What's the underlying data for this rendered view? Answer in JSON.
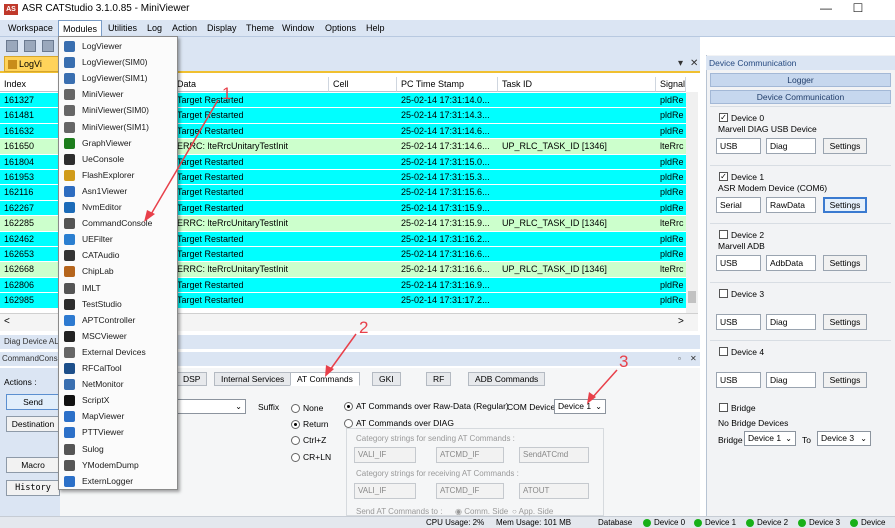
{
  "window": {
    "logo_text": "AS",
    "title": "ASR CATStudio 3.1.0.85 - MiniViewer",
    "minimize": "—",
    "maximize": "☐"
  },
  "menu": [
    "Workspace",
    "Modules",
    "Utilities",
    "Log",
    "Action",
    "Display",
    "Theme",
    "Window",
    "Options",
    "Help"
  ],
  "doc_tab": {
    "label": "LogVi"
  },
  "strip_controls": {
    "pin": "▾",
    "close": "✕"
  },
  "grid": {
    "columns": [
      "Index",
      "Data",
      "Cell",
      "PC Time Stamp",
      "Task ID",
      "Signal"
    ],
    "rows": [
      {
        "index": "161327",
        "data": "Target Restarted",
        "cell": "",
        "ts": "25-02-14 17:31:14.0...",
        "task": "",
        "signal": "pldRe",
        "hl": false
      },
      {
        "index": "161481",
        "data": "Target Restarted",
        "cell": "",
        "ts": "25-02-14 17:31:14.3...",
        "task": "",
        "signal": "pldRe",
        "hl": false
      },
      {
        "index": "161632",
        "data": "Target Restarted",
        "cell": "",
        "ts": "25-02-14 17:31:14.6...",
        "task": "",
        "signal": "pldRe",
        "hl": false
      },
      {
        "index": "161650",
        "data": "ERRC: lteRrcUnitaryTestInit",
        "cell": "",
        "ts": "25-02-14 17:31:14.6...",
        "task": "UP_RLC_TASK_ID [1346]",
        "signal": "lteRrc",
        "hl": true
      },
      {
        "index": "161804",
        "data": "Target Restarted",
        "cell": "",
        "ts": "25-02-14 17:31:15.0...",
        "task": "",
        "signal": "pldRe",
        "hl": false
      },
      {
        "index": "161953",
        "data": "Target Restarted",
        "cell": "",
        "ts": "25-02-14 17:31:15.3...",
        "task": "",
        "signal": "pldRe",
        "hl": false
      },
      {
        "index": "162116",
        "data": "Target Restarted",
        "cell": "",
        "ts": "25-02-14 17:31:15.6...",
        "task": "",
        "signal": "pldRe",
        "hl": false
      },
      {
        "index": "162267",
        "data": "Target Restarted",
        "cell": "",
        "ts": "25-02-14 17:31:15.9...",
        "task": "",
        "signal": "pldRe",
        "hl": false
      },
      {
        "index": "162285",
        "data": "ERRC: lteRrcUnitaryTestInit",
        "cell": "",
        "ts": "25-02-14 17:31:15.9...",
        "task": "UP_RLC_TASK_ID [1346]",
        "signal": "lteRrc",
        "hl": true
      },
      {
        "index": "162462",
        "data": "Target Restarted",
        "cell": "",
        "ts": "25-02-14 17:31:16.2...",
        "task": "",
        "signal": "pldRe",
        "hl": false
      },
      {
        "index": "162653",
        "data": "Target Restarted",
        "cell": "",
        "ts": "25-02-14 17:31:16.6...",
        "task": "",
        "signal": "pldRe",
        "hl": false
      },
      {
        "index": "162668",
        "data": "ERRC: lteRrcUnitaryTestInit",
        "cell": "",
        "ts": "25-02-14 17:31:16.6...",
        "task": "UP_RLC_TASK_ID [1346]",
        "signal": "lteRrc",
        "hl": true
      },
      {
        "index": "162806",
        "data": "Target Restarted",
        "cell": "",
        "ts": "25-02-14 17:31:16.9...",
        "task": "",
        "signal": "pldRe",
        "hl": false
      },
      {
        "index": "162985",
        "data": "Target Restarted",
        "cell": "",
        "ts": "25-02-14 17:31:17.2...",
        "task": "",
        "signal": "pldRe",
        "hl": false
      }
    ]
  },
  "scroll": {
    "left": "<",
    "right": ">"
  },
  "bottom": {
    "diag_strip": "Diag Device AL",
    "cmd_title": "CommandCons",
    "actions_label": "Actions :",
    "send": "Send",
    "destination": "Destination",
    "macro": "Macro",
    "history": "History",
    "tabs": [
      "DSP",
      "Internal Services",
      "AT Commands",
      "GKI",
      "RF",
      "ADB Commands"
    ],
    "active_tab": "AT Commands",
    "suffix_label": "Suffix",
    "suffix_options": [
      "None",
      "Return",
      "Ctrl+Z",
      "CR+LN"
    ],
    "suffix_selected": "Return",
    "mode_raw": "AT Commands over Raw-Data (Regular)",
    "mode_diag": "AT Commands over DIAG",
    "com_device_label": "COM Device:",
    "com_device_value": "Device 1",
    "send_cat_label": "Category strings for sending AT Commands :",
    "send_cat_values": [
      "VALI_IF",
      "ATCMD_IF",
      "SendATCmd"
    ],
    "recv_cat_label": "Category strings for receiving AT Commands :",
    "recv_cat_values": [
      "VALI_IF",
      "ATCMD_IF",
      "ATOUT"
    ],
    "send_to_label": "Send AT Commands to :",
    "send_to_options": [
      "Comm. Side",
      "App. Side"
    ]
  },
  "status": {
    "cpu": "CPU Usage: 2%",
    "mem": "Mem Usage: 101 MB",
    "db": "Database",
    "devices": [
      "Device 0",
      "Device 1",
      "Device 2",
      "Device 3",
      "Device"
    ]
  },
  "right_panel": {
    "title": "Device Communication",
    "logger_header": "Logger",
    "devcomm_header": "Device Communication",
    "devices": [
      {
        "name": "Device 0",
        "checked": true,
        "desc": "Marvell DIAG USB Device",
        "port": "USB",
        "proto": "Diag",
        "btn": "Settings"
      },
      {
        "name": "Device 1",
        "checked": true,
        "desc": "ASR Modem Device (COM6)",
        "port": "Serial",
        "proto": "RawData",
        "btn": "Settings"
      },
      {
        "name": "Device 2",
        "checked": false,
        "desc": "Marvell ADB",
        "port": "USB",
        "proto": "AdbData",
        "btn": "Settings"
      },
      {
        "name": "Device 3",
        "checked": false,
        "desc": "",
        "port": "USB",
        "proto": "Diag",
        "btn": "Settings"
      },
      {
        "name": "Device 4",
        "checked": false,
        "desc": "",
        "port": "USB",
        "proto": "Diag",
        "btn": "Settings"
      }
    ],
    "bridge": {
      "name": "Bridge",
      "desc": "No Bridge Devices",
      "label": "Bridge",
      "from": "Device 1",
      "to_label": "To",
      "to": "Device 3"
    }
  },
  "modules_menu": [
    {
      "label": "LogViewer",
      "icon": "magnifier-icon"
    },
    {
      "label": "LogViewer(SIM0)",
      "icon": "magnifier-icon"
    },
    {
      "label": "LogViewer(SIM1)",
      "icon": "magnifier-icon"
    },
    {
      "label": "MiniViewer",
      "icon": "mini-icon"
    },
    {
      "label": "MiniViewer(SIM0)",
      "icon": "mini-icon"
    },
    {
      "label": "MiniViewer(SIM1)",
      "icon": "mini-icon"
    },
    {
      "label": "GraphViewer",
      "icon": "graph-icon"
    },
    {
      "label": "UeConsole",
      "icon": "console-icon"
    },
    {
      "label": "FlashExplorer",
      "icon": "flash-icon"
    },
    {
      "label": "Asn1Viewer",
      "icon": "asn1-icon"
    },
    {
      "label": "NvmEditor",
      "icon": "nvm-icon"
    },
    {
      "label": "CommandConsole",
      "icon": "command-icon"
    },
    {
      "label": "UEFilter",
      "icon": "filter-icon"
    },
    {
      "label": "CATAudio",
      "icon": "audio-icon"
    },
    {
      "label": "ChipLab",
      "icon": "chip-icon"
    },
    {
      "label": "IMLT",
      "icon": "imlt-icon"
    },
    {
      "label": "TestStudio",
      "icon": "test-icon"
    },
    {
      "label": "APTController",
      "icon": "apt-icon"
    },
    {
      "label": "MSCViewer",
      "icon": "msc-icon"
    },
    {
      "label": "External Devices",
      "icon": "devices-icon"
    },
    {
      "label": "RFCalTool",
      "icon": "rf-icon"
    },
    {
      "label": "NetMonitor",
      "icon": "net-icon"
    },
    {
      "label": "ScriptX",
      "icon": "script-icon"
    },
    {
      "label": "MapViewer",
      "icon": "map-icon"
    },
    {
      "label": "PTTViewer",
      "icon": "ptt-icon"
    },
    {
      "label": "Sulog",
      "icon": "sulog-icon"
    },
    {
      "label": "YModemDump",
      "icon": "ymodem-icon"
    },
    {
      "label": "ExternLogger",
      "icon": "logger-icon"
    }
  ],
  "annotations": [
    "1",
    "2",
    "3"
  ],
  "colors": {
    "row": "#00ffff",
    "row_highlight": "#ccffcc",
    "accent": "#3a7ad0",
    "annotation": "#e8404a",
    "status_ok": "#18b018"
  }
}
